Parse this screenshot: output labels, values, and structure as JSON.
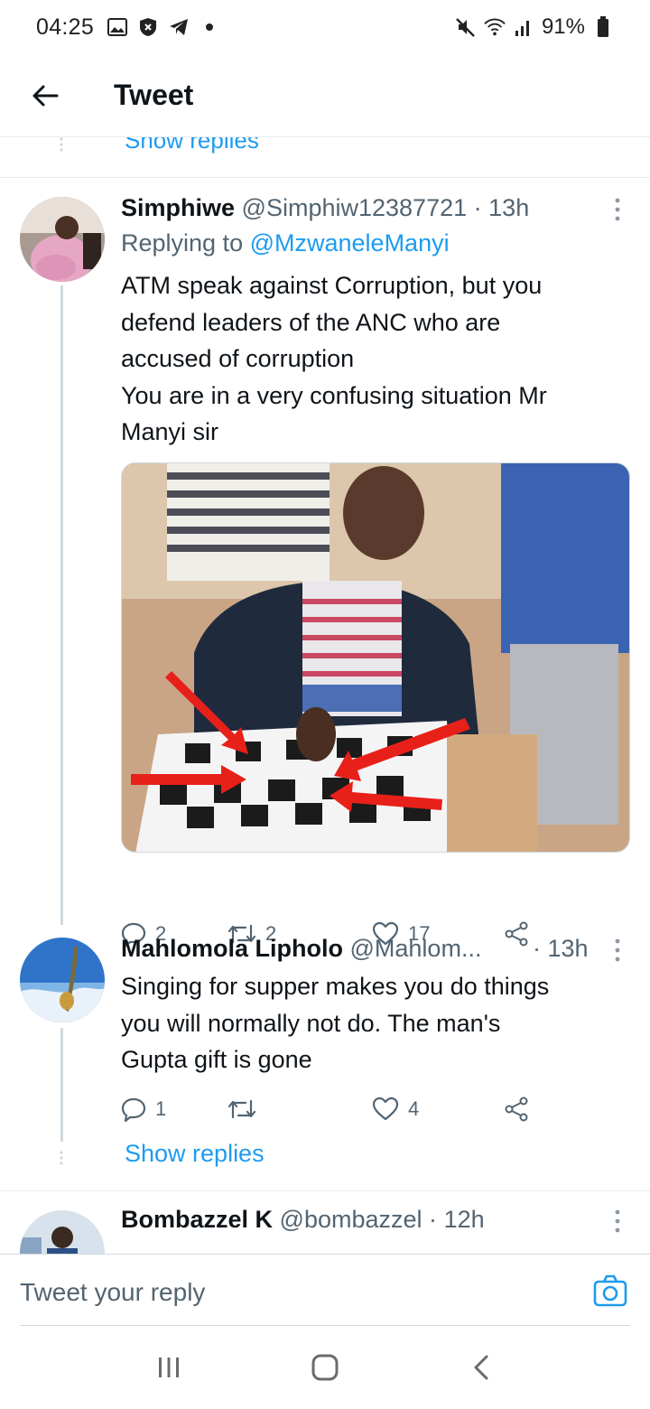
{
  "status_bar": {
    "time": "04:25",
    "battery": "91%",
    "icons_left": [
      "gallery-icon",
      "shield-icon",
      "telegram-icon",
      "dot-icon"
    ],
    "icons_right": [
      "mute-icon",
      "wifi-icon",
      "signal-icon",
      "battery-icon"
    ]
  },
  "header": {
    "title": "Tweet",
    "back_icon": "arrow-left-icon"
  },
  "top_show_replies": "Show replies",
  "tweets": [
    {
      "name": "Simphiwe",
      "handle": "@Simphiw12387721",
      "sep": "·",
      "time": "13h",
      "replying_prefix": "Replying to",
      "replying_to": "@MzwaneleManyi",
      "body_lines": [
        "ATM speak against Corruption,  but you",
        "defend leaders of the ANC who are",
        "accused of corruption",
        "You are in a very confusing situation Mr",
        "Manyi sir"
      ],
      "media": "photo of man playing chess with red arrows",
      "replies": "2",
      "retweets": "2",
      "likes": "17"
    },
    {
      "name": "Mahlomola Lipholo",
      "handle": "@Mahlom...",
      "sep": "·",
      "time": "13h",
      "body_lines": [
        "Singing for supper makes you do things",
        "you will normally not do. The man's",
        "Gupta gift is gone"
      ],
      "replies": "1",
      "retweets": "",
      "likes": "4",
      "show_replies": "Show replies"
    },
    {
      "name": "Bombazzel K",
      "handle": "@bombazzel",
      "sep": "·",
      "time": "12h"
    }
  ],
  "reply_bar": {
    "placeholder": "Tweet your reply",
    "camera_icon": "camera-icon"
  },
  "nav_bar": {
    "icons": [
      "recents-icon",
      "home-icon",
      "back-icon"
    ]
  },
  "colors": {
    "accent": "#1d9bf0",
    "text": "#0f1419",
    "muted": "#536471",
    "border": "#e6ecf0"
  }
}
